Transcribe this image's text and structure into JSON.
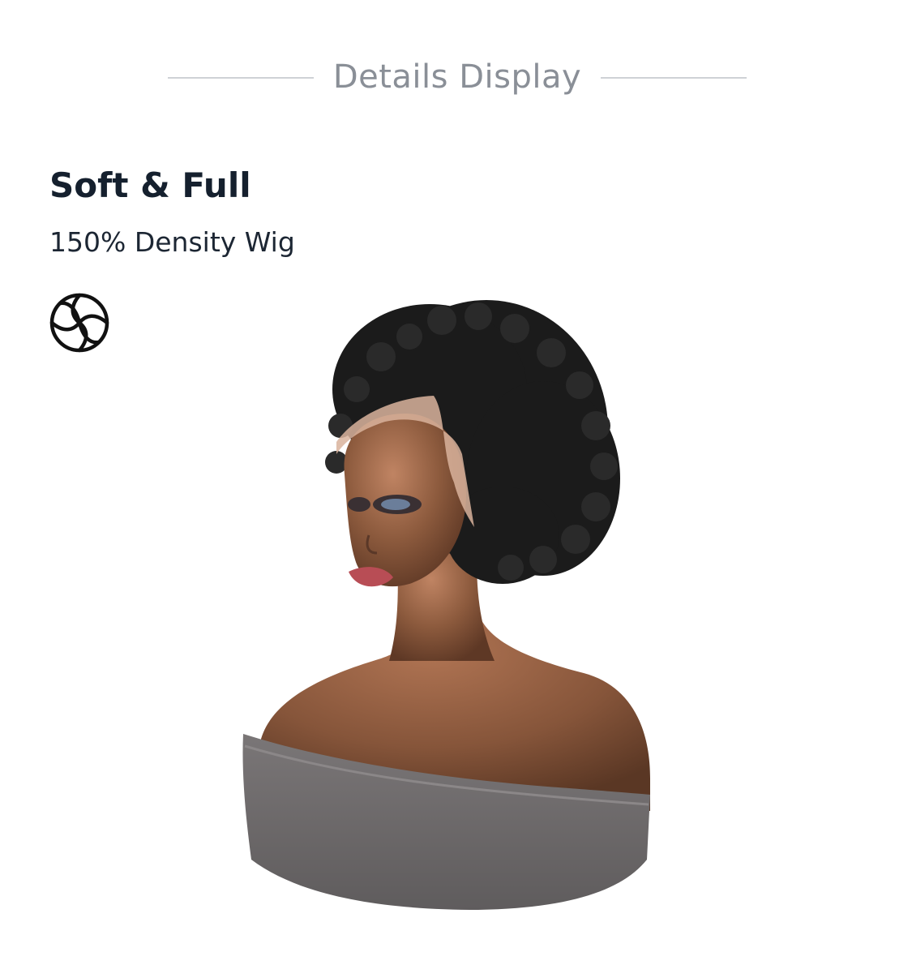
{
  "section_header": {
    "title": "Details Display"
  },
  "feature": {
    "title": "Soft & Full",
    "subtitle": "150% Density Wig",
    "icon": "aperture-icon"
  },
  "product_image": {
    "subject": "wig-on-mannequin-image"
  },
  "colors": {
    "header_text": "#8a8f97",
    "header_line": "#cfd2d6",
    "title_text": "#15202e",
    "hair": "#1b1b1b",
    "skin": "#8a5a3e",
    "lace": "#d9b39c",
    "drape": "#6d6a6b"
  }
}
